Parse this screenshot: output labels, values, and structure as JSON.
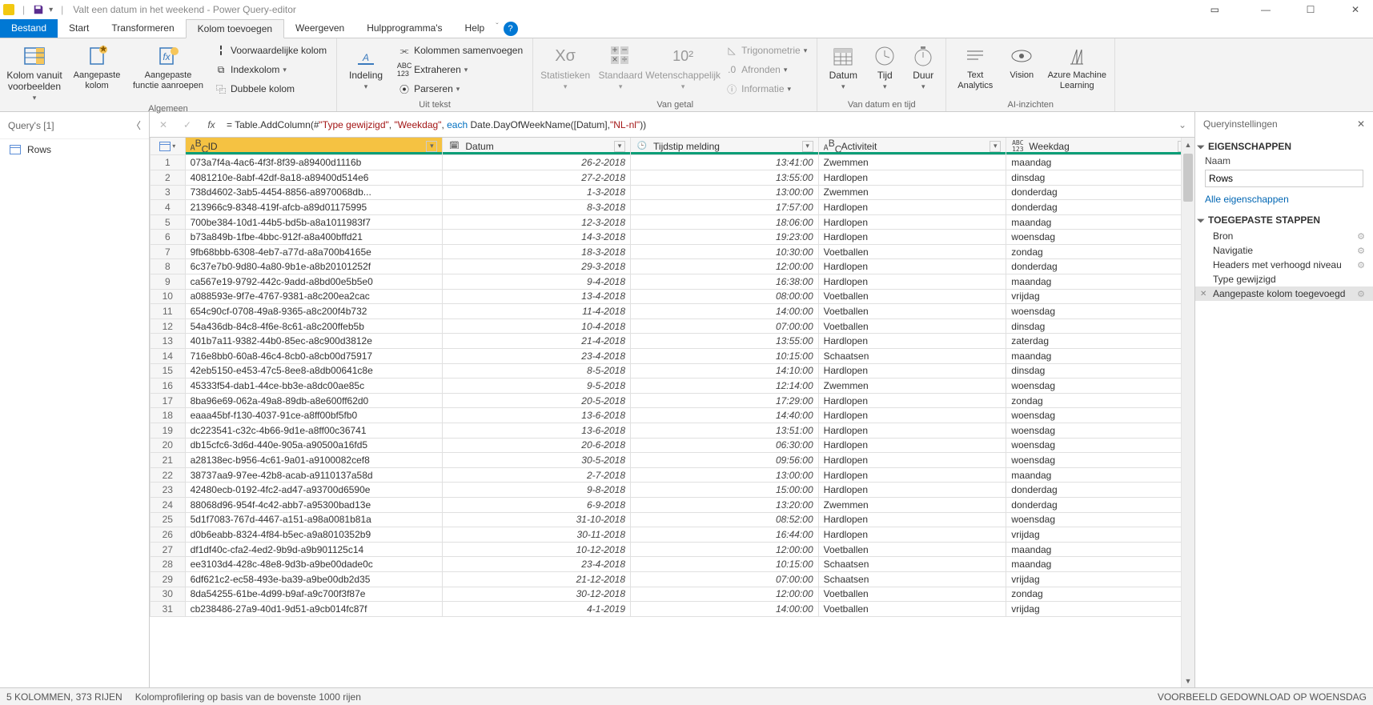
{
  "titlebar": {
    "title": "Valt een datum in het weekend - Power Query-editor"
  },
  "tabs": [
    "Bestand",
    "Start",
    "Transformeren",
    "Kolom toevoegen",
    "Weergeven",
    "Hulpprogramma's",
    "Help"
  ],
  "ribbon": {
    "algemeen": {
      "label": "Algemeen",
      "col_from_examples": "Kolom vanuit voorbeelden",
      "custom_col": "Aangepaste kolom",
      "custom_fn": "Aangepaste functie aanroepen",
      "cond_col": "Voorwaardelijke kolom",
      "index_col": "Indexkolom",
      "dup_col": "Dubbele kolom"
    },
    "uit_tekst": {
      "label": "Uit tekst",
      "indeling": "Indeling",
      "merge": "Kolommen samenvoegen",
      "extract": "Extraheren",
      "parse": "Parseren"
    },
    "van_getal": {
      "label": "Van getal",
      "stats": "Statistieken",
      "standard": "Standaard",
      "scientific": "Wetenschappelijk",
      "trig": "Trigonometrie",
      "round": "Afronden",
      "info": "Informatie"
    },
    "van_datum": {
      "label": "Van datum en tijd",
      "date": "Datum",
      "time": "Tijd",
      "duration": "Duur"
    },
    "ai": {
      "label": "AI-inzichten",
      "text_analytics": "Text Analytics",
      "vision": "Vision",
      "aml": "Azure Machine Learning"
    }
  },
  "queries": {
    "header": "Query's [1]",
    "items": [
      "Rows"
    ]
  },
  "formula": {
    "prefix": "= Table.AddColumn(#",
    "arg1": "\"Type gewijzigd\"",
    "sep1": ", ",
    "arg2": "\"Weekdag\"",
    "sep2": ", ",
    "kw": "each",
    "rest": " Date.DayOfWeekName([Datum],",
    "arg3": "\"NL-nl\"",
    "tail": "))"
  },
  "columns": [
    "ID",
    "Datum",
    "Tijdstip melding",
    "Activiteit",
    "Weekdag"
  ],
  "column_types": [
    "ABC",
    "cal",
    "clk",
    "ABC",
    "ABC123"
  ],
  "rows": [
    {
      "n": 1,
      "id": "073a7f4a-4ac6-4f3f-8f39-a89400d1116b",
      "date": "26-2-2018",
      "time": "13:41:00",
      "act": "Zwemmen",
      "wk": "maandag"
    },
    {
      "n": 2,
      "id": "4081210e-8abf-42df-8a18-a89400d514e6",
      "date": "27-2-2018",
      "time": "13:55:00",
      "act": "Hardlopen",
      "wk": "dinsdag"
    },
    {
      "n": 3,
      "id": "738d4602-3ab5-4454-8856-a8970068db...",
      "date": "1-3-2018",
      "time": "13:00:00",
      "act": "Zwemmen",
      "wk": "donderdag"
    },
    {
      "n": 4,
      "id": "213966c9-8348-419f-afcb-a89d01175995",
      "date": "8-3-2018",
      "time": "17:57:00",
      "act": "Hardlopen",
      "wk": "donderdag"
    },
    {
      "n": 5,
      "id": "700be384-10d1-44b5-bd5b-a8a1011983f7",
      "date": "12-3-2018",
      "time": "18:06:00",
      "act": "Hardlopen",
      "wk": "maandag"
    },
    {
      "n": 6,
      "id": "b73a849b-1fbe-4bbc-912f-a8a400bffd21",
      "date": "14-3-2018",
      "time": "19:23:00",
      "act": "Hardlopen",
      "wk": "woensdag"
    },
    {
      "n": 7,
      "id": "9fb68bbb-6308-4eb7-a77d-a8a700b4165e",
      "date": "18-3-2018",
      "time": "10:30:00",
      "act": "Voetballen",
      "wk": "zondag"
    },
    {
      "n": 8,
      "id": "6c37e7b0-9d80-4a80-9b1e-a8b20101252f",
      "date": "29-3-2018",
      "time": "12:00:00",
      "act": "Hardlopen",
      "wk": "donderdag"
    },
    {
      "n": 9,
      "id": "ca567e19-9792-442c-9add-a8bd00e5b5e0",
      "date": "9-4-2018",
      "time": "16:38:00",
      "act": "Hardlopen",
      "wk": "maandag"
    },
    {
      "n": 10,
      "id": "a088593e-9f7e-4767-9381-a8c200ea2cac",
      "date": "13-4-2018",
      "time": "08:00:00",
      "act": "Voetballen",
      "wk": "vrijdag"
    },
    {
      "n": 11,
      "id": "654c90cf-0708-49a8-9365-a8c200f4b732",
      "date": "11-4-2018",
      "time": "14:00:00",
      "act": "Voetballen",
      "wk": "woensdag"
    },
    {
      "n": 12,
      "id": "54a436db-84c8-4f6e-8c61-a8c200ffeb5b",
      "date": "10-4-2018",
      "time": "07:00:00",
      "act": "Voetballen",
      "wk": "dinsdag"
    },
    {
      "n": 13,
      "id": "401b7a11-9382-44b0-85ec-a8c900d3812e",
      "date": "21-4-2018",
      "time": "13:55:00",
      "act": "Hardlopen",
      "wk": "zaterdag"
    },
    {
      "n": 14,
      "id": "716e8bb0-60a8-46c4-8cb0-a8cb00d75917",
      "date": "23-4-2018",
      "time": "10:15:00",
      "act": "Schaatsen",
      "wk": "maandag"
    },
    {
      "n": 15,
      "id": "42eb5150-e453-47c5-8ee8-a8db00641c8e",
      "date": "8-5-2018",
      "time": "14:10:00",
      "act": "Hardlopen",
      "wk": "dinsdag"
    },
    {
      "n": 16,
      "id": "45333f54-dab1-44ce-bb3e-a8dc00ae85c",
      "date": "9-5-2018",
      "time": "12:14:00",
      "act": "Zwemmen",
      "wk": "woensdag"
    },
    {
      "n": 17,
      "id": "8ba96e69-062a-49a8-89db-a8e600ff62d0",
      "date": "20-5-2018",
      "time": "17:29:00",
      "act": "Hardlopen",
      "wk": "zondag"
    },
    {
      "n": 18,
      "id": "eaaa45bf-f130-4037-91ce-a8ff00bf5fb0",
      "date": "13-6-2018",
      "time": "14:40:00",
      "act": "Hardlopen",
      "wk": "woensdag"
    },
    {
      "n": 19,
      "id": "dc223541-c32c-4b66-9d1e-a8ff00c36741",
      "date": "13-6-2018",
      "time": "13:51:00",
      "act": "Hardlopen",
      "wk": "woensdag"
    },
    {
      "n": 20,
      "id": "db15cfc6-3d6d-440e-905a-a90500a16fd5",
      "date": "20-6-2018",
      "time": "06:30:00",
      "act": "Hardlopen",
      "wk": "woensdag"
    },
    {
      "n": 21,
      "id": "a28138ec-b956-4c61-9a01-a9100082cef8",
      "date": "30-5-2018",
      "time": "09:56:00",
      "act": "Hardlopen",
      "wk": "woensdag"
    },
    {
      "n": 22,
      "id": "38737aa9-97ee-42b8-acab-a9110137a58d",
      "date": "2-7-2018",
      "time": "13:00:00",
      "act": "Hardlopen",
      "wk": "maandag"
    },
    {
      "n": 23,
      "id": "42480ecb-0192-4fc2-ad47-a93700d6590e",
      "date": "9-8-2018",
      "time": "15:00:00",
      "act": "Hardlopen",
      "wk": "donderdag"
    },
    {
      "n": 24,
      "id": "88068d96-954f-4c42-abb7-a95300bad13e",
      "date": "6-9-2018",
      "time": "13:20:00",
      "act": "Zwemmen",
      "wk": "donderdag"
    },
    {
      "n": 25,
      "id": "5d1f7083-767d-4467-a151-a98a0081b81a",
      "date": "31-10-2018",
      "time": "08:52:00",
      "act": "Hardlopen",
      "wk": "woensdag"
    },
    {
      "n": 26,
      "id": "d0b6eabb-8324-4f84-b5ec-a9a8010352b9",
      "date": "30-11-2018",
      "time": "16:44:00",
      "act": "Hardlopen",
      "wk": "vrijdag"
    },
    {
      "n": 27,
      "id": "df1df40c-cfa2-4ed2-9b9d-a9b901125c14",
      "date": "10-12-2018",
      "time": "12:00:00",
      "act": "Voetballen",
      "wk": "maandag"
    },
    {
      "n": 28,
      "id": "ee3103d4-428c-48e8-9d3b-a9be00dade0c",
      "date": "23-4-2018",
      "time": "10:15:00",
      "act": "Schaatsen",
      "wk": "maandag"
    },
    {
      "n": 29,
      "id": "6df621c2-ec58-493e-ba39-a9be00db2d35",
      "date": "21-12-2018",
      "time": "07:00:00",
      "act": "Schaatsen",
      "wk": "vrijdag"
    },
    {
      "n": 30,
      "id": "8da54255-61be-4d99-b9af-a9c700f3f87e",
      "date": "30-12-2018",
      "time": "12:00:00",
      "act": "Voetballen",
      "wk": "zondag"
    },
    {
      "n": 31,
      "id": "cb238486-27a9-40d1-9d51-a9cb014fc87f",
      "date": "4-1-2019",
      "time": "14:00:00",
      "act": "Voetballen",
      "wk": "vrijdag"
    }
  ],
  "settings": {
    "header": "Queryinstellingen",
    "props_title": "EIGENSCHAPPEN",
    "name_label": "Naam",
    "name_value": "Rows",
    "all_props": "Alle eigenschappen",
    "steps_title": "TOEGEPASTE STAPPEN",
    "steps": [
      {
        "label": "Bron",
        "gear": true
      },
      {
        "label": "Navigatie",
        "gear": true
      },
      {
        "label": "Headers met verhoogd niveau",
        "gear": true
      },
      {
        "label": "Type gewijzigd",
        "gear": false
      },
      {
        "label": "Aangepaste kolom toegevoegd",
        "gear": true,
        "selected": true,
        "x": true
      }
    ]
  },
  "status": {
    "left": "5 KOLOMMEN, 373 RIJEN",
    "mid": "Kolomprofilering op basis van de bovenste 1000 rijen",
    "right": "VOORBEELD GEDOWNLOAD OP WOENSDAG"
  }
}
